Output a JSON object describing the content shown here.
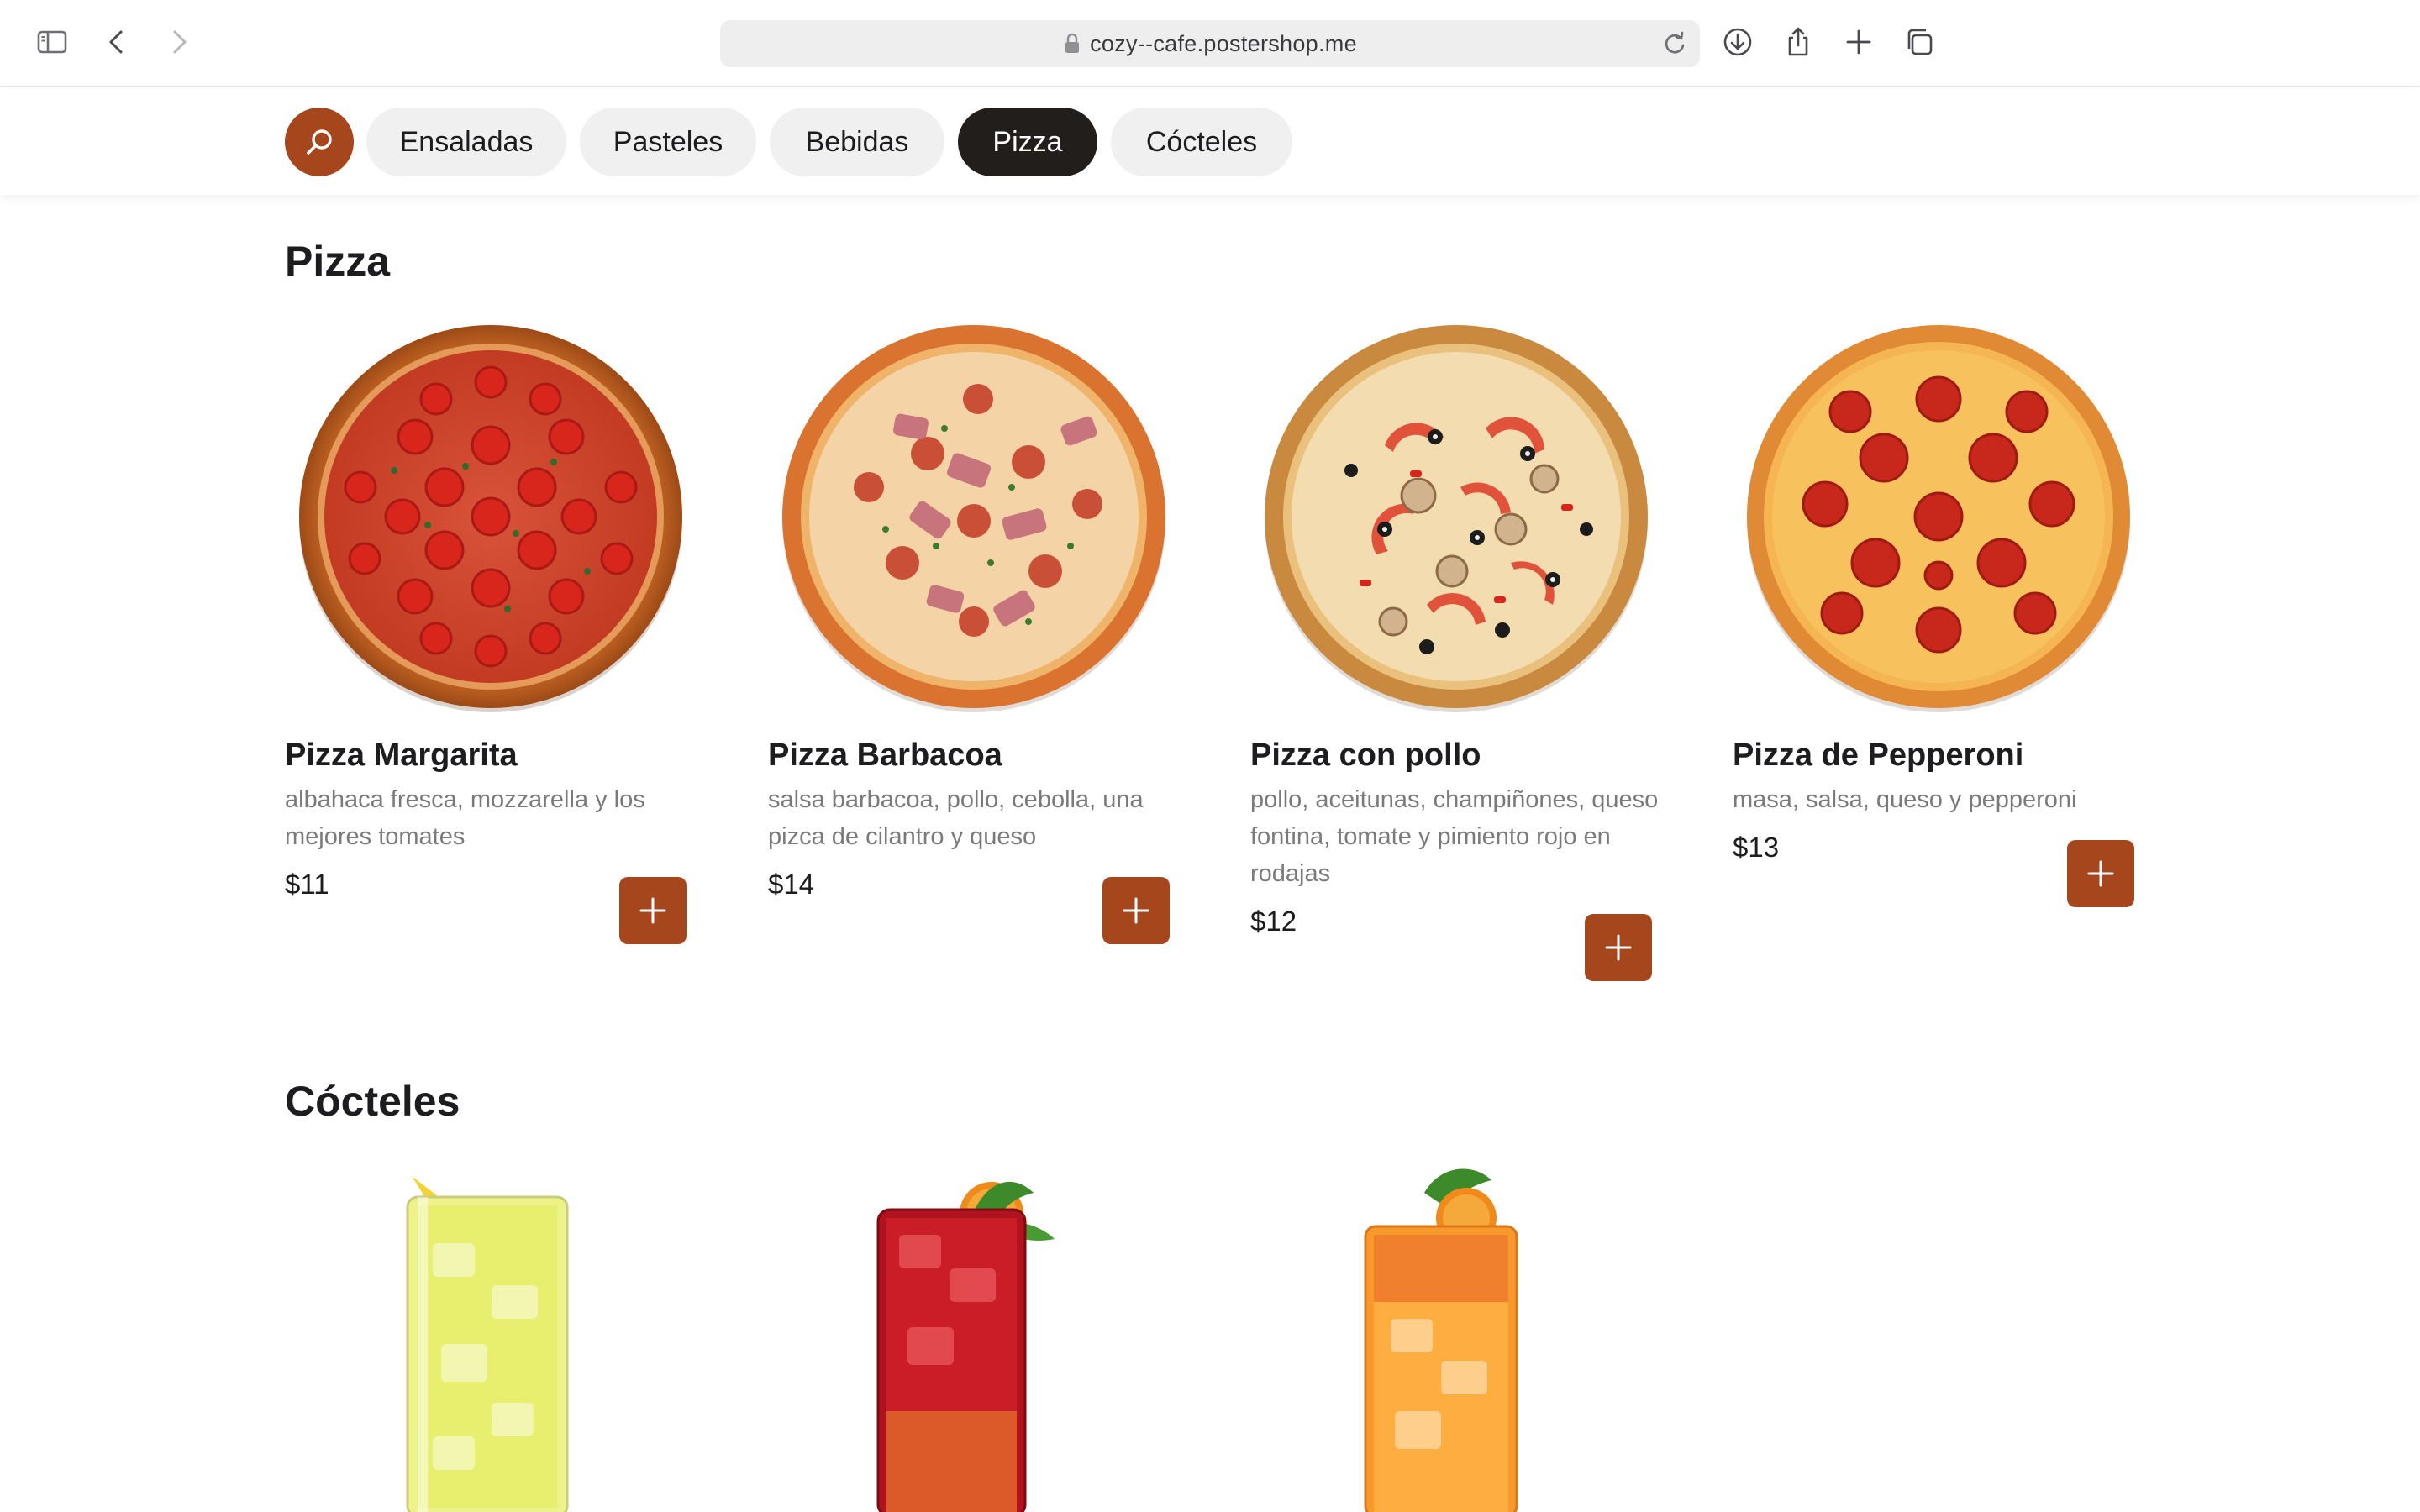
{
  "browser": {
    "url": "cozy--cafe.postershop.me",
    "icons": [
      "sidebar-icon",
      "back-icon",
      "forward-icon",
      "lock-icon",
      "reload-icon",
      "download-icon",
      "share-icon",
      "new-tab-icon",
      "tabs-overview-icon"
    ]
  },
  "nav": {
    "search_icon": "search-icon",
    "categories": [
      {
        "label": "Ensaladas",
        "active": false
      },
      {
        "label": "Pasteles",
        "active": false
      },
      {
        "label": "Bebidas",
        "active": false
      },
      {
        "label": "Pizza",
        "active": true
      },
      {
        "label": "Cócteles",
        "active": false
      }
    ]
  },
  "colors": {
    "accent": "#a5461d",
    "active_pill": "#211e1c",
    "pill": "#f0f0f0",
    "description": "#7a7a7a"
  },
  "sections": {
    "pizza": {
      "title": "Pizza",
      "items": [
        {
          "name": "Pizza Margarita",
          "description": "albahaca fresca, mozzarella y los mejores tomates",
          "price": "$11",
          "add_icon": "plus-icon"
        },
        {
          "name": "Pizza Barbacoa",
          "description": "salsa barbacoa, pollo, cebolla, una pizca de cilantro y queso",
          "price": "$14",
          "add_icon": "plus-icon"
        },
        {
          "name": "Pizza con pollo",
          "description": "pollo, aceitunas, champiñones, queso fontina, tomate y pimiento rojo en rodajas",
          "price": "$12",
          "add_icon": "plus-icon"
        },
        {
          "name": "Pizza de Pepperoni",
          "description": "masa, salsa, queso y pepperoni",
          "price": "$13",
          "add_icon": "plus-icon"
        }
      ]
    },
    "cocktails": {
      "title": "Cócteles"
    }
  }
}
